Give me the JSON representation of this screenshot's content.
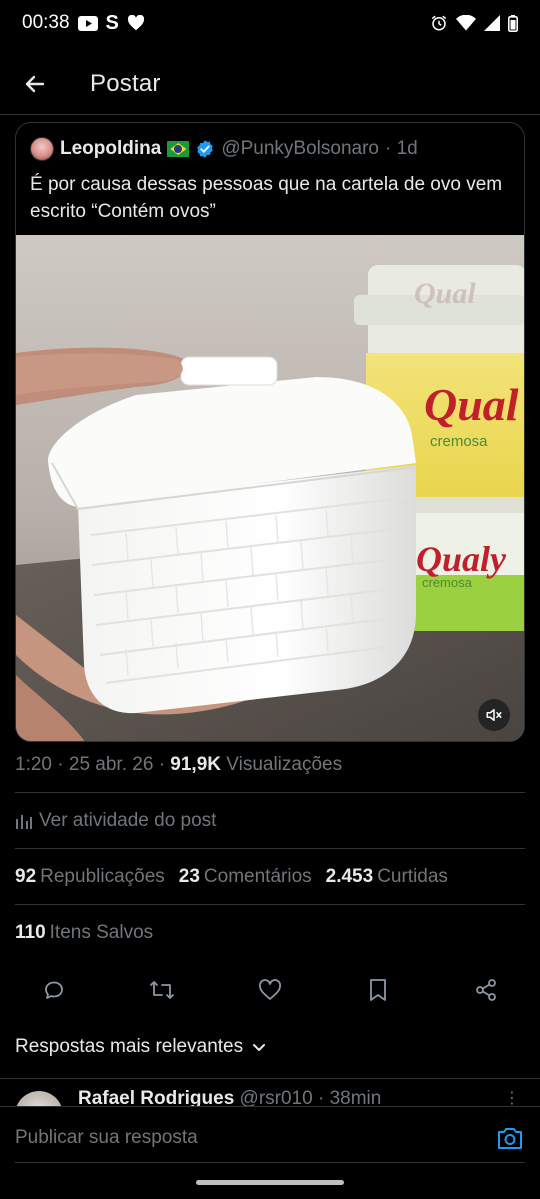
{
  "status_bar": {
    "time": "00:38",
    "left_icons": [
      "youtube-icon",
      "s-icon",
      "heart-icon"
    ],
    "right_icons": [
      "alarm-icon",
      "wifi-icon",
      "signal-icon",
      "battery-icon"
    ],
    "s_glyph": "S"
  },
  "header": {
    "title": "Postar"
  },
  "quoted_post": {
    "author_name": "Leopoldina",
    "author_handle": "@PunkyBolsonaro",
    "time_ago": "· 1d",
    "text": "É por causa dessas pessoas que na cartela de ovo vem escrito “Contém ovos”",
    "media": {
      "brand_label_1": "Qual",
      "brand_sub_1": "cremosa",
      "brand_label_2": "Qualy",
      "brand_sub_2": "cremosa"
    }
  },
  "post_meta": {
    "time": "1:20",
    "date": "25 abr. 26",
    "separator": "·",
    "views_count": "91,9K",
    "views_label": "Visualizações"
  },
  "activity": {
    "label": "Ver atividade do post"
  },
  "stats": {
    "reposts_count": "92",
    "reposts_label": "Republicações",
    "comments_count": "23",
    "comments_label": "Comentários",
    "likes_count": "2.453",
    "likes_label": "Curtidas",
    "saved_count": "110",
    "saved_label": "Itens Salvos"
  },
  "actions": [
    "reply-icon",
    "repost-icon",
    "like-icon",
    "bookmark-icon",
    "share-icon"
  ],
  "replies": {
    "sort_label": "Respostas mais relevantes",
    "first_reply": {
      "name": "Rafael Rodrigues",
      "handle": "@rsr010",
      "time": "· 38min",
      "more": "⋮"
    }
  },
  "composer": {
    "placeholder": "Publicar sua resposta"
  },
  "colors": {
    "background": "#000000",
    "text_primary": "#e7e9ea",
    "text_secondary": "#71767b",
    "border": "#2f3336",
    "accent": "#1d9bf0"
  }
}
